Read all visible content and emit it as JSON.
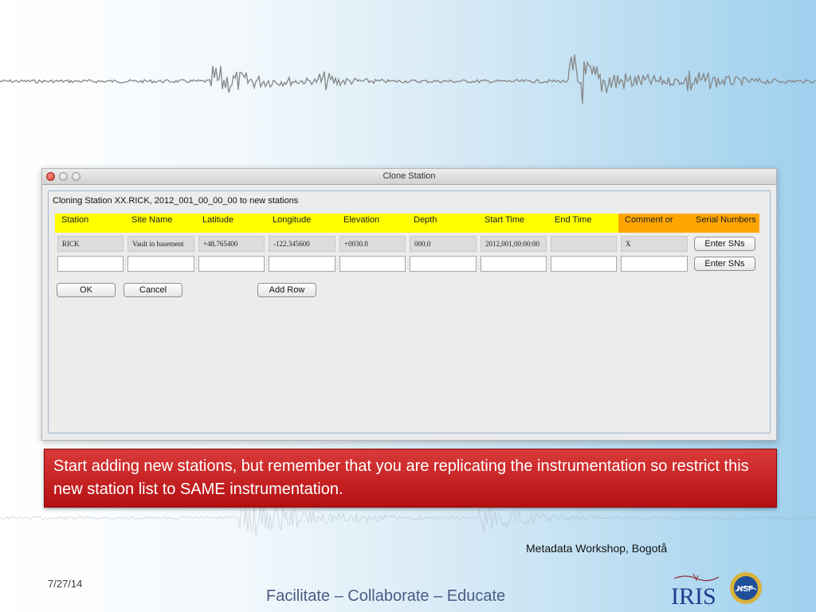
{
  "window": {
    "title": "Clone Station",
    "panel_title": "Cloning Station XX.RICK, 2012_001_00_00_00 to new stations"
  },
  "columns": [
    {
      "label": "Station",
      "color": "#ffff00"
    },
    {
      "label": "Site Name",
      "color": "#ffff00"
    },
    {
      "label": "Latitude",
      "color": "#ffff00"
    },
    {
      "label": "Longitude",
      "color": "#ffff00"
    },
    {
      "label": "Elevation",
      "color": "#ffff00"
    },
    {
      "label": "Depth",
      "color": "#ffff00"
    },
    {
      "label": "Start Time",
      "color": "#ffff00"
    },
    {
      "label": "End Time",
      "color": "#ffff00"
    },
    {
      "label": "Comment or",
      "color": "#ffa500"
    },
    {
      "label": "Serial Numbers",
      "color": "#ffa500"
    }
  ],
  "rows": [
    {
      "cells": [
        "RICK",
        "Vault in basement",
        "+48.765400",
        "-122.345600",
        "+0030.0",
        "000.0",
        "2012,001,00:00:00",
        "",
        "X"
      ],
      "serial_button": "Enter SNs"
    },
    {
      "cells": [
        "",
        "",
        "",
        "",
        "",
        "",
        "",
        "",
        ""
      ],
      "serial_button": "Enter SNs"
    }
  ],
  "buttons": {
    "ok": "OK",
    "cancel": "Cancel",
    "add_row": "Add Row"
  },
  "banner": {
    "text": "Start adding new stations, but remember that you are replicating the instrumentation so restrict this new station list to SAME instrumentation.",
    "color": "#c41a1c"
  },
  "footer": {
    "workshop": "Metadata Workshop, Bogotå",
    "date": "7/27/14",
    "tagline": "Facilitate – Collaborate – Educate",
    "logo_text": "IRIS",
    "nsf_text": "NSF"
  }
}
